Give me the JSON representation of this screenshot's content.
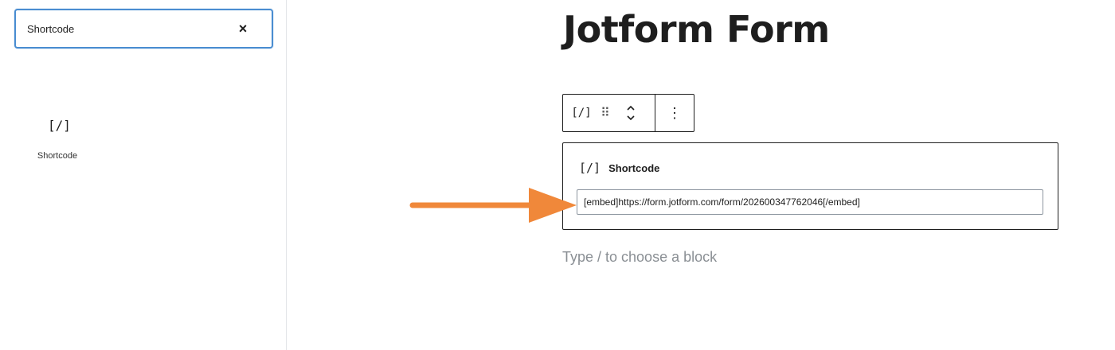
{
  "sidebar": {
    "search": {
      "value": "Shortcode",
      "clear_icon": "close-icon"
    },
    "results": [
      {
        "icon": "[/]",
        "label": "Shortcode"
      }
    ]
  },
  "editor": {
    "title": "Jotform Form",
    "toolbar": {
      "block_type_icon": "[/]",
      "drag_icon": "⠿",
      "more_icon": "⋮"
    },
    "shortcode_block": {
      "icon": "[/]",
      "label": "Shortcode",
      "value": "[embed]https://form.jotform.com/form/202600347762046[/embed]"
    },
    "appender_placeholder": "Type / to choose a block"
  },
  "colors": {
    "focus_border": "#4a8dd1",
    "annotation_arrow": "#f0883a",
    "placeholder_text": "#8a8f94"
  }
}
